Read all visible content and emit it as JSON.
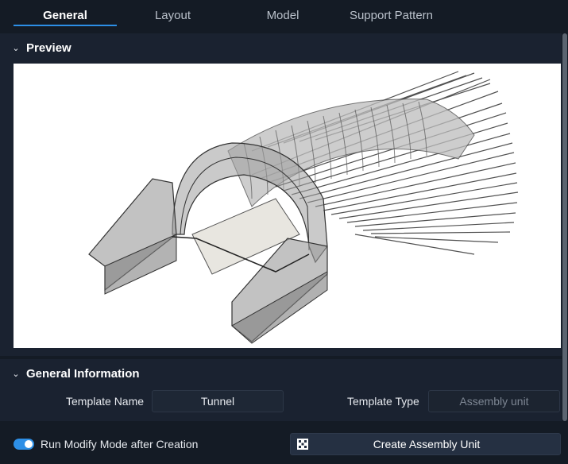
{
  "tabs": [
    {
      "label": "General",
      "active": true
    },
    {
      "label": "Layout",
      "active": false
    },
    {
      "label": "Model",
      "active": false
    },
    {
      "label": "Support Pattern",
      "active": false
    }
  ],
  "preview": {
    "title": "Preview",
    "icon": "chevron-down-icon"
  },
  "general_information": {
    "title": "General Information",
    "template_name_label": "Template Name",
    "template_name_value": "Tunnel",
    "template_type_label": "Template Type",
    "template_type_value": "Assembly unit"
  },
  "footer": {
    "toggle_label": "Run Modify Mode after Creation",
    "toggle_on": true,
    "create_button_label": "Create Assembly Unit",
    "create_button_icon": "assembly-icon"
  },
  "colors": {
    "accent": "#2d8fe6",
    "background": "#141b25",
    "panel": "#1a2230"
  }
}
